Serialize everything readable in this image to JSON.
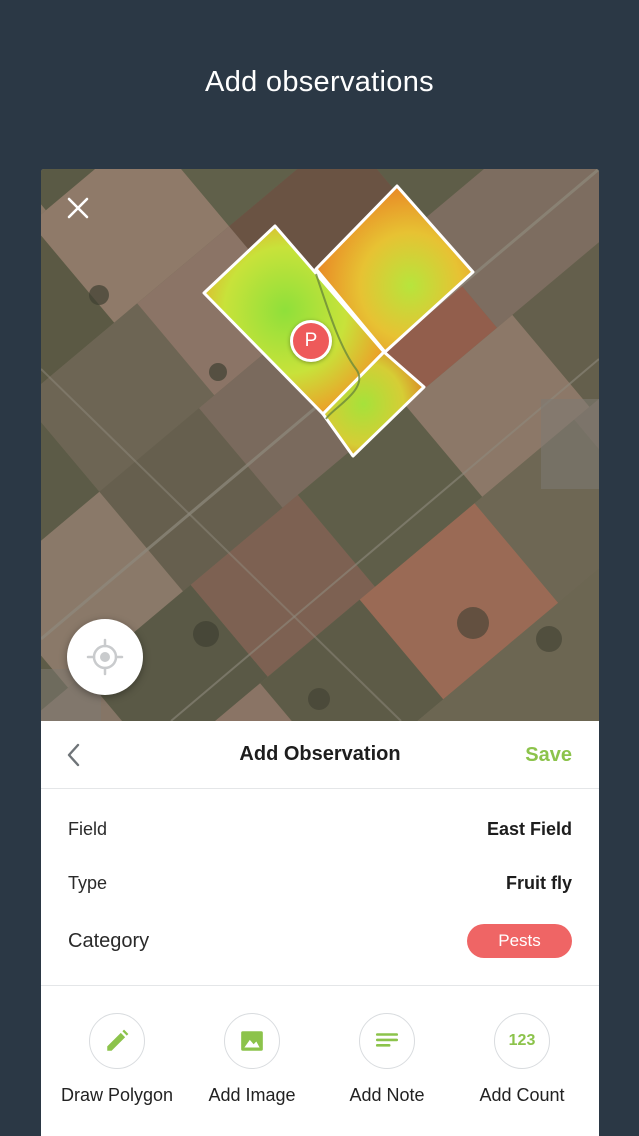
{
  "screen": {
    "heading": "Add observations"
  },
  "map": {
    "close_icon": "close-icon",
    "locate_icon": "crosshair-icon",
    "marker_label": "P",
    "marker_color": "#ee5a5a"
  },
  "sheet": {
    "title": "Add Observation",
    "back_icon": "chevron-left-icon",
    "save_label": "Save",
    "accent_color": "#8cc34b",
    "fields": {
      "field_label": "Field",
      "field_value": "East Field",
      "type_label": "Type",
      "type_value": "Fruit fly",
      "category_label": "Category",
      "category_value": "Pests",
      "category_color": "#ef6565"
    },
    "actions": [
      {
        "label": "Draw Polygon",
        "icon": "pencil-icon"
      },
      {
        "label": "Add Image",
        "icon": "image-icon"
      },
      {
        "label": "Add Note",
        "icon": "note-lines-icon"
      },
      {
        "label": "Add Count",
        "icon": "count-icon",
        "icon_text": "123"
      }
    ]
  }
}
